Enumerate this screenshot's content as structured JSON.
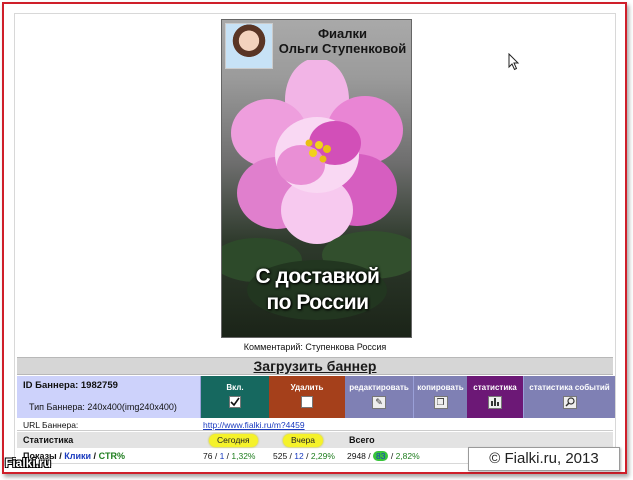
{
  "banner": {
    "title_line1": "Фиалки",
    "title_line2": "Ольги Ступенковой",
    "slogan_line1": "С доставкой",
    "slogan_line2": "по России"
  },
  "comment": "Комментарий: Ступенкова Россия",
  "upload": {
    "label": "Загрузить баннер"
  },
  "info": {
    "id_label": "ID Баннера: 1982759",
    "type_label": "Тип Баннера:  240x400(img240x400)"
  },
  "actions": {
    "enable": "Вкл.",
    "delete": "Удалить",
    "edit": "редактировать",
    "copy": "копировать",
    "stats": "статистика",
    "event_stats": "статистика событий"
  },
  "url": {
    "label": "URL Баннера:",
    "value": "http://www.fialki.ru/m?4459"
  },
  "stats": {
    "label": "Статистика",
    "today": "Сегодня",
    "yesterday": "Вчера",
    "total": "Всего",
    "row_shows": "Показы",
    "row_clicks": "Клики",
    "row_ctr": "CTR%",
    "today_values": {
      "shows": "76",
      "clicks": "1",
      "ctr": "1,32%"
    },
    "yesterday_values": {
      "shows": "525",
      "clicks": "12",
      "ctr": "2,29%"
    },
    "total_values": {
      "shows": "2948",
      "clicks": "83",
      "ctr": "2,82%"
    }
  },
  "watermarks": {
    "left": "Fialki.ru",
    "right": "© Fialki.ru, 2013"
  },
  "colors": {
    "frame": "#cf1f2a",
    "enable_bg": "#16685f",
    "delete_bg": "#a5401b",
    "action_bg": "#7f80b4",
    "stats_bg": "#6c1876",
    "id_bg": "#cdd2fb",
    "pill": "#f5f22a",
    "highlight": "#38c53a"
  }
}
